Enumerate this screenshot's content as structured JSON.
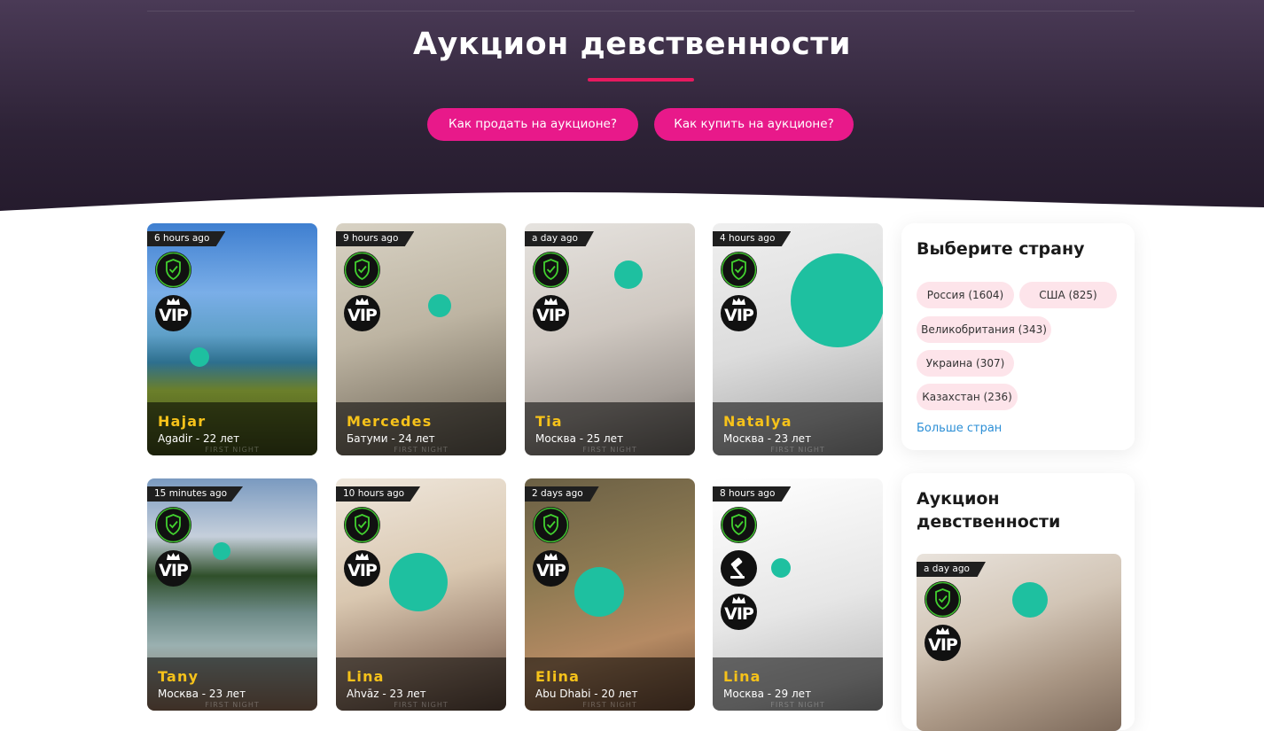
{
  "hero": {
    "title": "Аукцион девственности",
    "btn_sell": "Как продать на аукционе?",
    "btn_buy": "Как купить на аукционе?"
  },
  "colors": {
    "accent": "#e8198a",
    "underline": "#e8195f",
    "name": "#f6c21a",
    "face_blur": "#1ec0a0",
    "chip": "#fde4ea",
    "link": "#2c8fd6"
  },
  "cards": [
    {
      "time": "6 hours ago",
      "name": "Hajar",
      "loc": "Agadir - 22 лет",
      "badges": [
        "shield-icon",
        "vip-icon"
      ]
    },
    {
      "time": "9 hours ago",
      "name": "Mercedes",
      "loc": "Батуми - 24 лет",
      "badges": [
        "shield-icon",
        "vip-icon"
      ]
    },
    {
      "time": "a day ago",
      "name": "Tia",
      "loc": "Москва - 25 лет",
      "badges": [
        "shield-icon",
        "vip-icon"
      ]
    },
    {
      "time": "4 hours ago",
      "name": "Natalya",
      "loc": "Москва - 23 лет",
      "badges": [
        "shield-icon",
        "vip-icon"
      ]
    },
    {
      "time": "15 minutes ago",
      "name": "Tany",
      "loc": "Москва - 23 лет",
      "badges": [
        "shield-icon",
        "vip-icon"
      ]
    },
    {
      "time": "10 hours ago",
      "name": "Lina",
      "loc": "Ahvāz - 23 лет",
      "badges": [
        "shield-icon",
        "vip-icon"
      ]
    },
    {
      "time": "2 days ago",
      "name": "Elina",
      "loc": "Abu Dhabi - 20 лет",
      "badges": [
        "shield-icon",
        "vip-icon"
      ]
    },
    {
      "time": "8 hours ago",
      "name": "Lina",
      "loc": "Москва - 29 лет",
      "badges": [
        "shield-icon",
        "gavel-icon",
        "vip-icon"
      ]
    }
  ],
  "watermark": "FIRST NIGHT",
  "countries": {
    "title": "Выберите страну",
    "items": [
      "Россия (1604)",
      "США (825)",
      "Великобритания (343)",
      "Украина (307)",
      "Казахстан (236)"
    ],
    "more": "Больше стран"
  },
  "side": {
    "title_line1": "Аукцион",
    "title_line2": "девственности",
    "card_time": "a day ago"
  }
}
